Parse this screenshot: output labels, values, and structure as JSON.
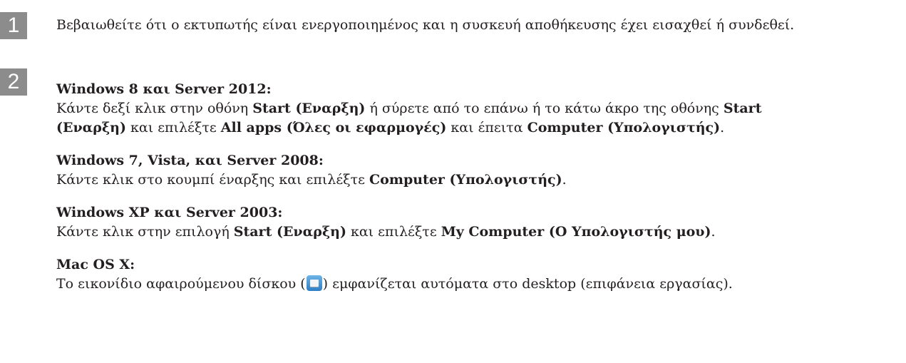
{
  "steps": [
    {
      "number": "1",
      "text": "Βεβαιωθείτε ότι ο εκτυπωτής είναι ενεργοποιημένος και η συσκευή αποθήκευσης έχει εισαχθεί ή συνδεθεί."
    },
    {
      "number": "2",
      "sections": {
        "win8": {
          "heading": "Windows 8 και Server 2012:",
          "l1_a": "Κάντε δεξί κλικ στην οθόνη ",
          "l1_b": "Start (Εναρξη)",
          "l1_c": " ή σύρετε από το επάνω ή το κάτω άκρο της οθόνης ",
          "l1_d": "Start",
          "l2_a": "(Εναρξη)",
          "l2_b": " και επιλέξτε ",
          "l2_c": "All apps (Όλες οι εφαρμογές)",
          "l2_d": " και έπειτα ",
          "l2_e": "Computer (Υπολογιστής)",
          "l2_f": "."
        },
        "win7": {
          "heading": "Windows 7, Vista, και Server 2008:",
          "l1_a": "Κάντε κλικ στο κουμπί έναρξης και επιλέξτε ",
          "l1_b": "Computer (Υπολογιστής)",
          "l1_c": "."
        },
        "winxp": {
          "heading": "Windows XP και Server 2003:",
          "l1_a": "Κάντε κλικ στην επιλογή ",
          "l1_b": "Start (Εναρξη)",
          "l1_c": " και επιλέξτε ",
          "l1_d": "My Computer (Ο Υπολογιστής μου)",
          "l1_e": "."
        },
        "mac": {
          "heading": "Mac OS X:",
          "l1_a": "Το εικονίδιο αφαιρούμενου δίσκου (",
          "icon": "removable-disk-icon",
          "l1_b": ") εμφανίζεται αυτόματα στο desktop (επιφάνεια εργασίας)."
        }
      }
    }
  ]
}
